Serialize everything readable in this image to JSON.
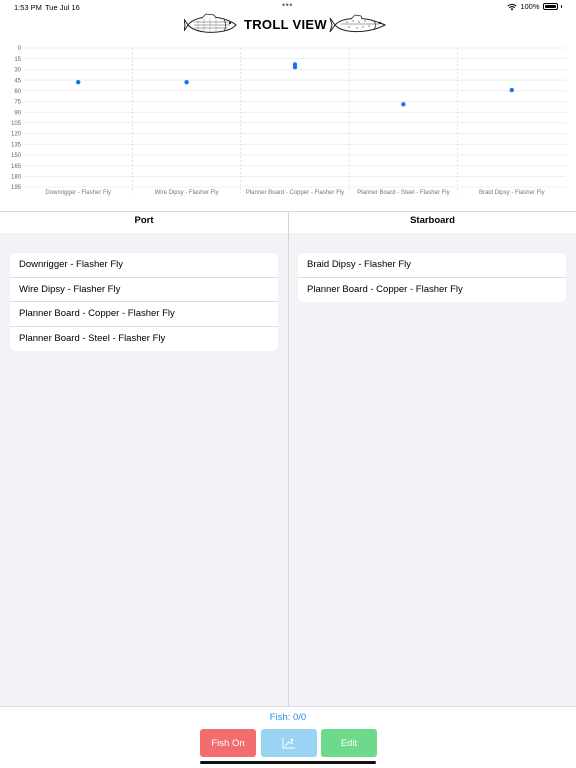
{
  "status_bar": {
    "time": "1:53 PM",
    "date": "Tue Jul 16",
    "dots": "•••",
    "battery_pct": "100%",
    "wifi_icon": "wifi-icon",
    "battery_icon": "battery-icon"
  },
  "header": {
    "title": "TROLL VIEW",
    "left_icon": "bass-fish-icon",
    "right_icon": "trout-fish-icon"
  },
  "chart_data": {
    "type": "scatter",
    "categories": [
      "Downrigger - Flasher Fly",
      "Wire Dipsy - Flasher Fly",
      "Planner Board - Copper - Flasher Fly",
      "Planner Board - Steel - Flasher Fly",
      "Braid Dipsy - Flasher Fly"
    ],
    "y_ticks": [
      0,
      15,
      30,
      45,
      60,
      75,
      90,
      105,
      120,
      135,
      150,
      165,
      180,
      195
    ],
    "y_tick_labels": [
      "0",
      "15",
      "30",
      "45",
      "60",
      "75",
      "90",
      "105",
      "120",
      "135",
      "150",
      "165",
      "180",
      "195"
    ],
    "ylim": [
      0,
      195
    ],
    "y_inverted": true,
    "grid": true,
    "points": [
      {
        "category": "Downrigger - Flasher Fly",
        "y": 48
      },
      {
        "category": "Wire Dipsy - Flasher Fly",
        "y": 48
      },
      {
        "category": "Planner Board - Copper - Flasher Fly",
        "y": 23
      },
      {
        "category": "Planner Board - Copper - Flasher Fly",
        "y": 27
      },
      {
        "category": "Planner Board - Steel - Flasher Fly",
        "y": 79
      },
      {
        "category": "Braid Dipsy - Flasher Fly",
        "y": 59
      }
    ],
    "point_color": "#1a73e8"
  },
  "port": {
    "label": "Port",
    "items": [
      "Downrigger - Flasher Fly",
      "Wire Dipsy - Flasher Fly",
      "Planner Board - Copper - Flasher Fly",
      "Planner Board - Steel - Flasher Fly"
    ]
  },
  "starboard": {
    "label": "Starboard",
    "items": [
      "Braid Dipsy - Flasher Fly",
      "Planner Board - Copper - Flasher Fly"
    ]
  },
  "footer": {
    "fish_count": "Fish: 0/0",
    "fish_on_label": "Fish On",
    "chart_button_icon": "fishing-chart-icon",
    "edit_label": "Edit"
  },
  "colors": {
    "fish_on": "#f26d6d",
    "chart_button": "#9bd3f2",
    "edit": "#6ed98a",
    "accent": "#2f8ce6"
  }
}
